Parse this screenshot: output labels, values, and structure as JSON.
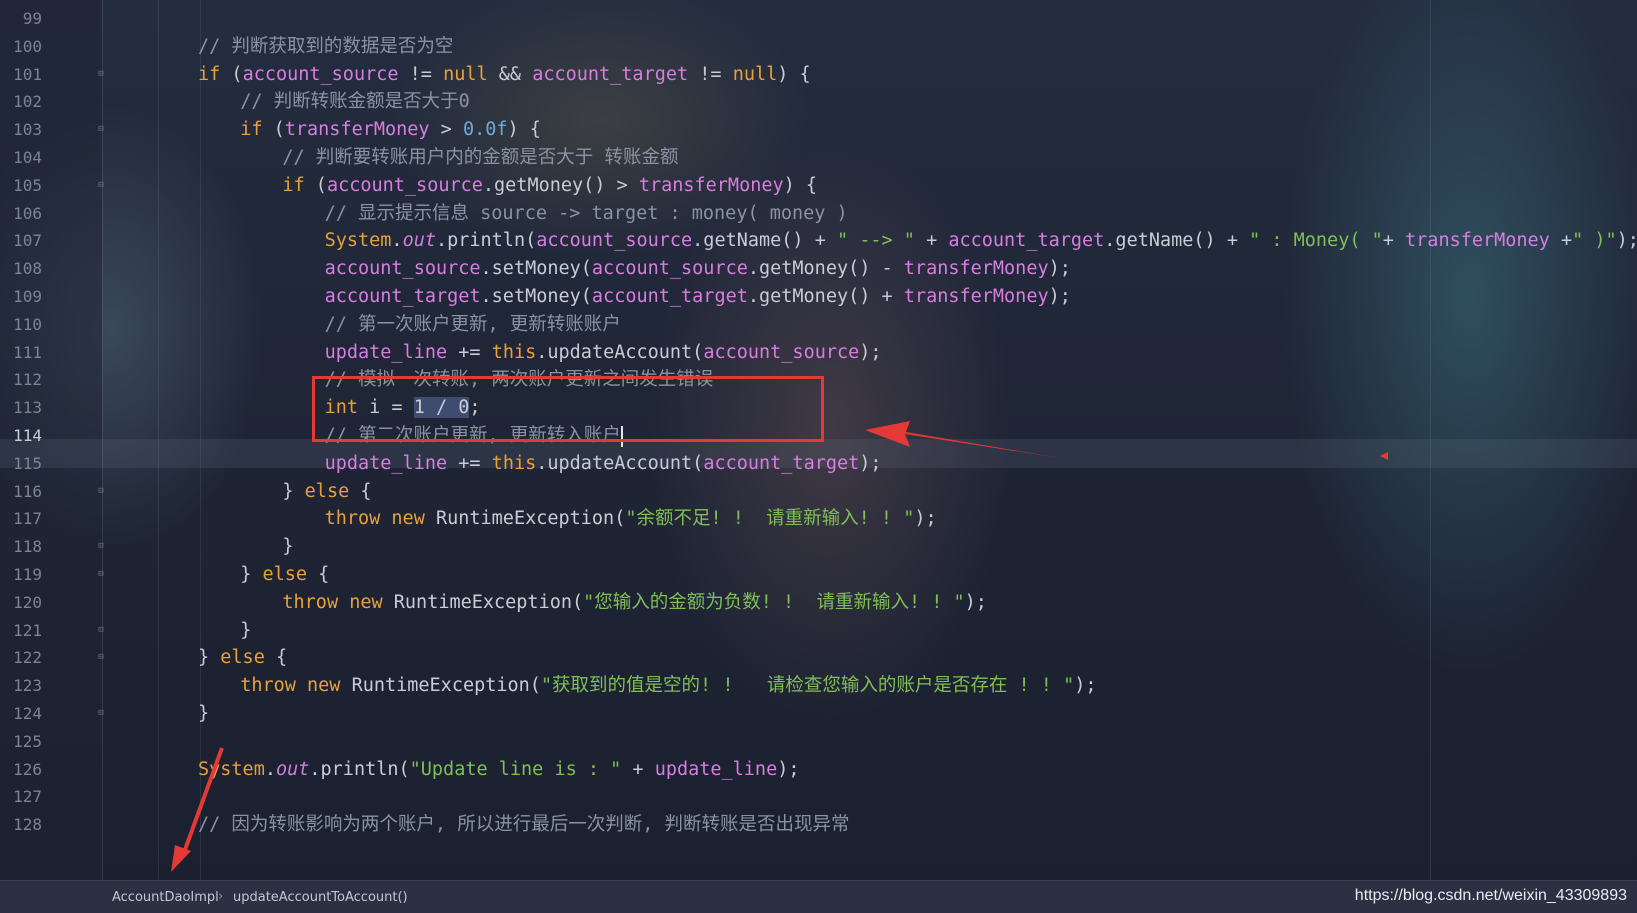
{
  "editor": {
    "lines": [
      {
        "num": "99",
        "indent": 0,
        "tokens": []
      },
      {
        "num": "100",
        "indent": 4,
        "tokens": [
          [
            "c",
            "// 判断获取到的数据是否为空"
          ]
        ]
      },
      {
        "num": "101",
        "indent": 4,
        "fold": "⊟",
        "tokens": [
          [
            "k",
            "if"
          ],
          [
            "p",
            " ("
          ],
          [
            "v",
            "account_source"
          ],
          [
            "p",
            " != "
          ],
          [
            "k",
            "null"
          ],
          [
            "p",
            " && "
          ],
          [
            "v",
            "account_target"
          ],
          [
            "p",
            " != "
          ],
          [
            "k",
            "null"
          ],
          [
            "p",
            ") {"
          ]
        ]
      },
      {
        "num": "102",
        "indent": 8,
        "tokens": [
          [
            "c",
            "// 判断转账金额是否大于0"
          ]
        ]
      },
      {
        "num": "103",
        "indent": 8,
        "fold": "⊟",
        "tokens": [
          [
            "k",
            "if"
          ],
          [
            "p",
            " ("
          ],
          [
            "v",
            "transferMoney"
          ],
          [
            "p",
            " > "
          ],
          [
            "n",
            "0.0f"
          ],
          [
            "p",
            ") {"
          ]
        ]
      },
      {
        "num": "104",
        "indent": 12,
        "tokens": [
          [
            "c",
            "// 判断要转账用户内的金额是否大于 转账金额"
          ]
        ]
      },
      {
        "num": "105",
        "indent": 12,
        "fold": "⊟",
        "tokens": [
          [
            "k",
            "if"
          ],
          [
            "p",
            " ("
          ],
          [
            "v",
            "account_source"
          ],
          [
            "p",
            ".getMoney() > "
          ],
          [
            "v",
            "transferMoney"
          ],
          [
            "p",
            ") {"
          ]
        ]
      },
      {
        "num": "106",
        "indent": 16,
        "tokens": [
          [
            "c",
            "// 显示提示信息 source -> target : money( money )"
          ]
        ]
      },
      {
        "num": "107",
        "indent": 16,
        "tokens": [
          [
            "f",
            "System"
          ],
          [
            "p",
            "."
          ],
          [
            "st",
            "out"
          ],
          [
            "p",
            ".println("
          ],
          [
            "v",
            "account_source"
          ],
          [
            "p",
            ".getName() + "
          ],
          [
            "s",
            "\" --> \""
          ],
          [
            "p",
            " + "
          ],
          [
            "v",
            "account_target"
          ],
          [
            "p",
            ".getName() + "
          ],
          [
            "s",
            "\" : Money( \""
          ],
          [
            "p",
            "+ "
          ],
          [
            "v",
            "transferMoney"
          ],
          [
            "p",
            " +"
          ],
          [
            "s",
            "\" )\""
          ],
          [
            "p",
            ");"
          ]
        ]
      },
      {
        "num": "108",
        "indent": 16,
        "tokens": [
          [
            "v",
            "account_source"
          ],
          [
            "p",
            ".setMoney("
          ],
          [
            "v",
            "account_source"
          ],
          [
            "p",
            ".getMoney() - "
          ],
          [
            "v",
            "transferMoney"
          ],
          [
            "p",
            ");"
          ]
        ]
      },
      {
        "num": "109",
        "indent": 16,
        "tokens": [
          [
            "v",
            "account_target"
          ],
          [
            "p",
            ".setMoney("
          ],
          [
            "v",
            "account_target"
          ],
          [
            "p",
            ".getMoney() + "
          ],
          [
            "v",
            "transferMoney"
          ],
          [
            "p",
            ");"
          ]
        ]
      },
      {
        "num": "110",
        "indent": 16,
        "tokens": [
          [
            "c",
            "// 第一次账户更新, 更新转账账户"
          ]
        ]
      },
      {
        "num": "111",
        "indent": 16,
        "tokens": [
          [
            "v",
            "update_line"
          ],
          [
            "p",
            " += "
          ],
          [
            "k",
            "this"
          ],
          [
            "p",
            ".updateAccount("
          ],
          [
            "v",
            "account_source"
          ],
          [
            "p",
            ");"
          ]
        ]
      },
      {
        "num": "112",
        "indent": 16,
        "tokens": [
          [
            "c",
            "// 模拟一次转账, 两次账户更新之间发生错误"
          ]
        ]
      },
      {
        "num": "113",
        "indent": 16,
        "tokens": [
          [
            "k",
            "int"
          ],
          [
            "p",
            " i = "
          ],
          [
            "sel",
            "1 / 0"
          ],
          [
            "p",
            ";"
          ]
        ]
      },
      {
        "num": "114",
        "indent": 16,
        "active": true,
        "caret": true,
        "tokens": [
          [
            "c",
            "// 第二次账户更新, 更新转入账户"
          ]
        ]
      },
      {
        "num": "115",
        "indent": 16,
        "tokens": [
          [
            "v",
            "update_line"
          ],
          [
            "p",
            " += "
          ],
          [
            "k",
            "this"
          ],
          [
            "p",
            ".updateAccount("
          ],
          [
            "v",
            "account_target"
          ],
          [
            "p",
            ");"
          ]
        ]
      },
      {
        "num": "116",
        "indent": 12,
        "fold": "⊟",
        "tokens": [
          [
            "p",
            "} "
          ],
          [
            "k",
            "else"
          ],
          [
            "p",
            " {"
          ]
        ]
      },
      {
        "num": "117",
        "indent": 16,
        "tokens": [
          [
            "k",
            "throw new"
          ],
          [
            "p",
            " RuntimeException("
          ],
          [
            "s",
            "\"余额不足! !  请重新输入! ! \""
          ],
          [
            "p",
            ");"
          ]
        ]
      },
      {
        "num": "118",
        "indent": 12,
        "fold": "⊡",
        "tokens": [
          [
            "p",
            "}"
          ]
        ]
      },
      {
        "num": "119",
        "indent": 8,
        "fold": "⊟",
        "tokens": [
          [
            "p",
            "} "
          ],
          [
            "k",
            "else"
          ],
          [
            "p",
            " {"
          ]
        ]
      },
      {
        "num": "120",
        "indent": 12,
        "tokens": [
          [
            "k",
            "throw new"
          ],
          [
            "p",
            " RuntimeException("
          ],
          [
            "s",
            "\"您输入的金额为负数! !  请重新输入! ! \""
          ],
          [
            "p",
            ");"
          ]
        ]
      },
      {
        "num": "121",
        "indent": 8,
        "fold": "⊡",
        "tokens": [
          [
            "p",
            "}"
          ]
        ]
      },
      {
        "num": "122",
        "indent": 4,
        "fold": "⊟",
        "tokens": [
          [
            "p",
            "} "
          ],
          [
            "k",
            "else"
          ],
          [
            "p",
            " {"
          ]
        ]
      },
      {
        "num": "123",
        "indent": 8,
        "tokens": [
          [
            "k",
            "throw new"
          ],
          [
            "p",
            " RuntimeException("
          ],
          [
            "s",
            "\"获取到的值是空的! !   请检查您输入的账户是否存在 ! ! \""
          ],
          [
            "p",
            ");"
          ]
        ]
      },
      {
        "num": "124",
        "indent": 4,
        "fold": "⊡",
        "tokens": [
          [
            "p",
            "}"
          ]
        ]
      },
      {
        "num": "125",
        "indent": 0,
        "tokens": []
      },
      {
        "num": "126",
        "indent": 4,
        "tokens": [
          [
            "f",
            "System"
          ],
          [
            "p",
            "."
          ],
          [
            "st",
            "out"
          ],
          [
            "p",
            ".println("
          ],
          [
            "s",
            "\"Update line is : \""
          ],
          [
            "p",
            " + "
          ],
          [
            "v",
            "update_line"
          ],
          [
            "p",
            ");"
          ]
        ]
      },
      {
        "num": "127",
        "indent": 0,
        "tokens": []
      },
      {
        "num": "128",
        "indent": 4,
        "tokens": [
          [
            "c",
            "// 因为转账影响为两个账户, 所以进行最后一次判断, 判断转账是否出现异常"
          ]
        ]
      }
    ]
  },
  "status_bar": {
    "class_name": "AccountDaoImpl",
    "separator": "›",
    "method_name": "updateAccountToAccount()"
  },
  "watermark": "https://blog.csdn.net/weixin_43309893",
  "colors": {
    "keyword": "#e8a13a",
    "comment": "#8a93a3",
    "string": "#7fbf56",
    "variable": "#d77ee0",
    "annotation_red": "#e53935"
  }
}
